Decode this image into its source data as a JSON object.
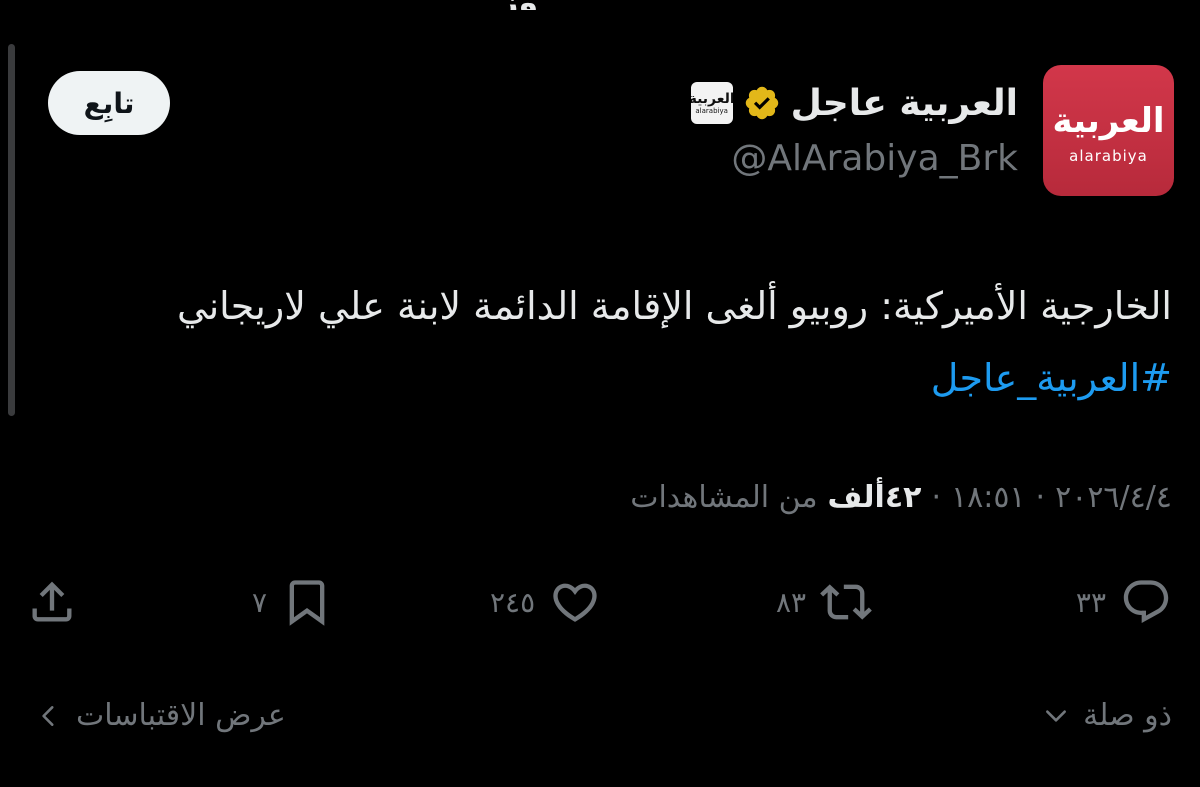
{
  "top_partial_text": "وز",
  "author": {
    "display_name": "العربية عاجل",
    "handle": "@AlArabiya_Brk",
    "avatar_text_ar": "العربية",
    "avatar_text_en": "alarabiya",
    "affiliation_text_ar": "العربية",
    "affiliation_text_en": "alarabiya"
  },
  "follow_button": {
    "label": "تابِع"
  },
  "tweet": {
    "text": "الخارجية الأميركية: روبيو ألغى الإقامة الدائمة لابنة علي لاريجاني",
    "hashtag": "#العربية_عاجل"
  },
  "meta": {
    "date": "٢٠٢٦/٤/٤",
    "separator": "·",
    "time": "١٨:٥١",
    "views_count": "٤٢ألف",
    "views_label": "من المشاهدات"
  },
  "actions": {
    "replies": "٣٣",
    "reposts": "٨٣",
    "likes": "٢٤٥",
    "bookmarks": "٧"
  },
  "footer": {
    "related_label": "ذو صلة",
    "quotes_label": "عرض الاقتباسات"
  },
  "colors": {
    "background": "#000000",
    "text": "#e7e9ea",
    "muted": "#71767b",
    "link": "#1d9bf0",
    "avatar": "#c8303f",
    "verified": "#e2b719"
  }
}
